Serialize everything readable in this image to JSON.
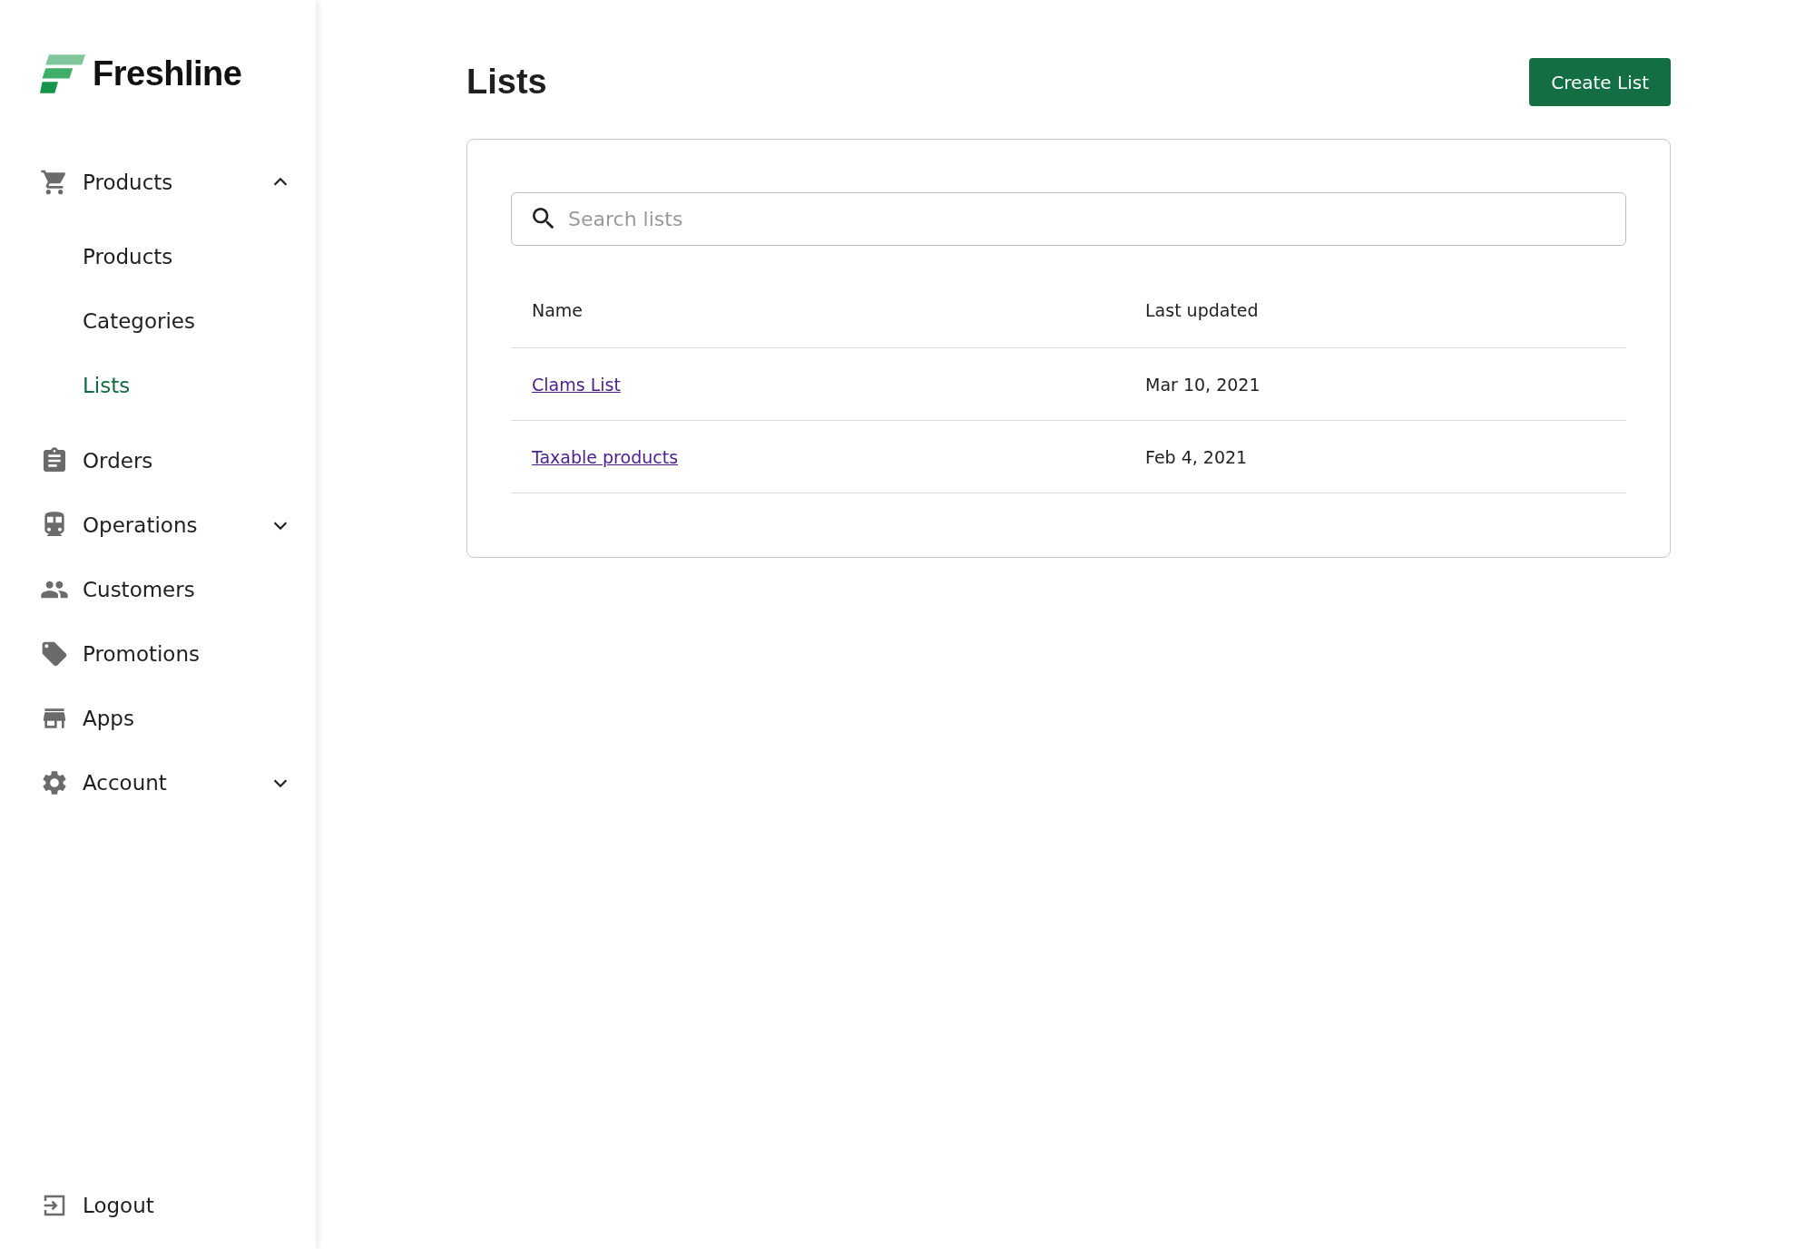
{
  "brand": {
    "name": "Freshline"
  },
  "sidebar": {
    "items": [
      {
        "label": "Products",
        "selected": false,
        "expanded": true,
        "children": [
          {
            "label": "Products",
            "selected": false
          },
          {
            "label": "Categories",
            "selected": false
          },
          {
            "label": "Lists",
            "selected": true
          }
        ]
      },
      {
        "label": "Orders",
        "selected": false
      },
      {
        "label": "Operations",
        "selected": false,
        "expanded": false
      },
      {
        "label": "Customers",
        "selected": false
      },
      {
        "label": "Promotions",
        "selected": false
      },
      {
        "label": "Apps",
        "selected": false
      },
      {
        "label": "Account",
        "selected": false,
        "expanded": false
      }
    ],
    "logout": {
      "label": "Logout"
    }
  },
  "page": {
    "title": "Lists",
    "primary_button": "Create List"
  },
  "search": {
    "placeholder": "Search lists"
  },
  "table": {
    "columns": [
      "Name",
      "Last updated"
    ],
    "rows": [
      {
        "name": "Clams List",
        "last_updated": "Mar 10, 2021"
      },
      {
        "name": "Taxable products",
        "last_updated": "Feb 4, 2021"
      }
    ]
  }
}
